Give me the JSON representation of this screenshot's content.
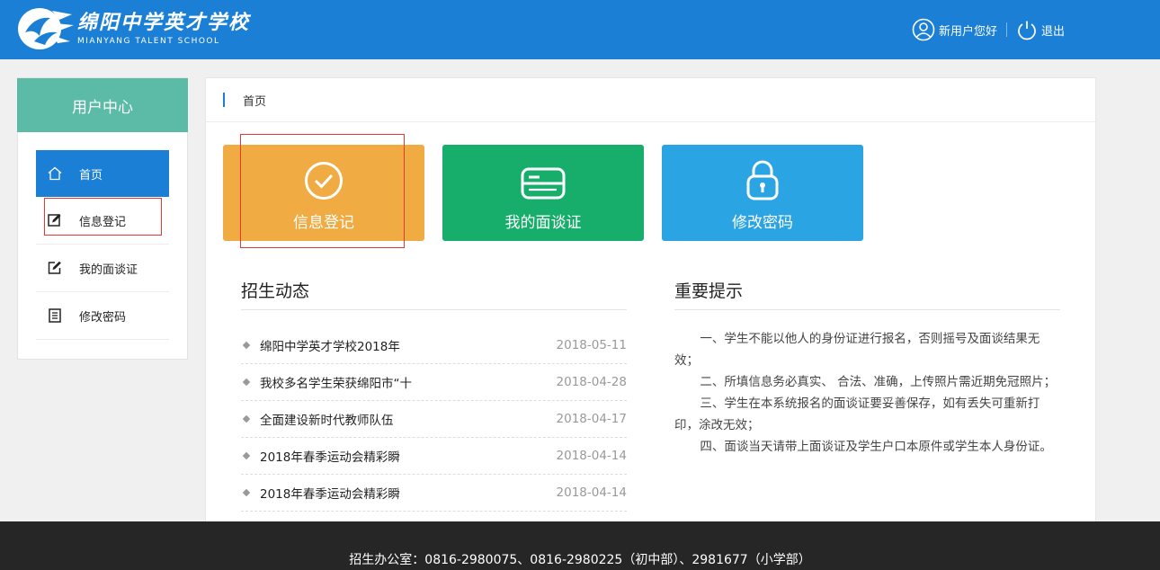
{
  "header": {
    "logo_cn": "绵阳中学英才学校",
    "logo_en": "MIANYANG TALENT SCHOOL",
    "user_greeting": "新用户您好",
    "logout_label": "退出"
  },
  "sidebar": {
    "title": "用户中心",
    "items": [
      {
        "label": "首页",
        "icon": "home-icon",
        "active": true
      },
      {
        "label": "信息登记",
        "icon": "edit-icon"
      },
      {
        "label": "我的面谈证",
        "icon": "edit-square-icon"
      },
      {
        "label": "修改密码",
        "icon": "document-list-icon"
      }
    ]
  },
  "breadcrumb": "首页",
  "tiles": [
    {
      "label": "信息登记",
      "icon": "check-circle-icon",
      "color": "#f0ab42"
    },
    {
      "label": "我的面谈证",
      "icon": "card-icon",
      "color": "#17ad6a"
    },
    {
      "label": "修改密码",
      "icon": "lock-icon",
      "color": "#2aa4e2"
    }
  ],
  "news": {
    "title": "招生动态",
    "items": [
      {
        "title": "绵阳中学英才学校2018年",
        "date": "2018-05-11"
      },
      {
        "title": "我校多名学生荣获绵阳市“十",
        "date": "2018-04-28"
      },
      {
        "title": "全面建设新时代教师队伍",
        "date": "2018-04-17"
      },
      {
        "title": "2018年春季运动会精彩瞬",
        "date": "2018-04-14"
      },
      {
        "title": "2018年春季运动会精彩瞬",
        "date": "2018-04-14"
      }
    ]
  },
  "tips": {
    "title": "重要提示",
    "items": [
      "一、学生不能以他人的身份证进行报名，否则摇号及面谈结果无效；",
      "二、所填信息务必真实、 合法、准确，上传照片需近期免冠照片；",
      "三、学生在本系统报名的面谈证要妥善保存，如有丢失可重新打印，涂改无效；",
      "四、面谈当天请带上面谈证及学生户口本原件或学生本人身份证。"
    ]
  },
  "footer": "招生办公室：0816-2980075、0816-2980225（初中部）、2981677（小学部）"
}
